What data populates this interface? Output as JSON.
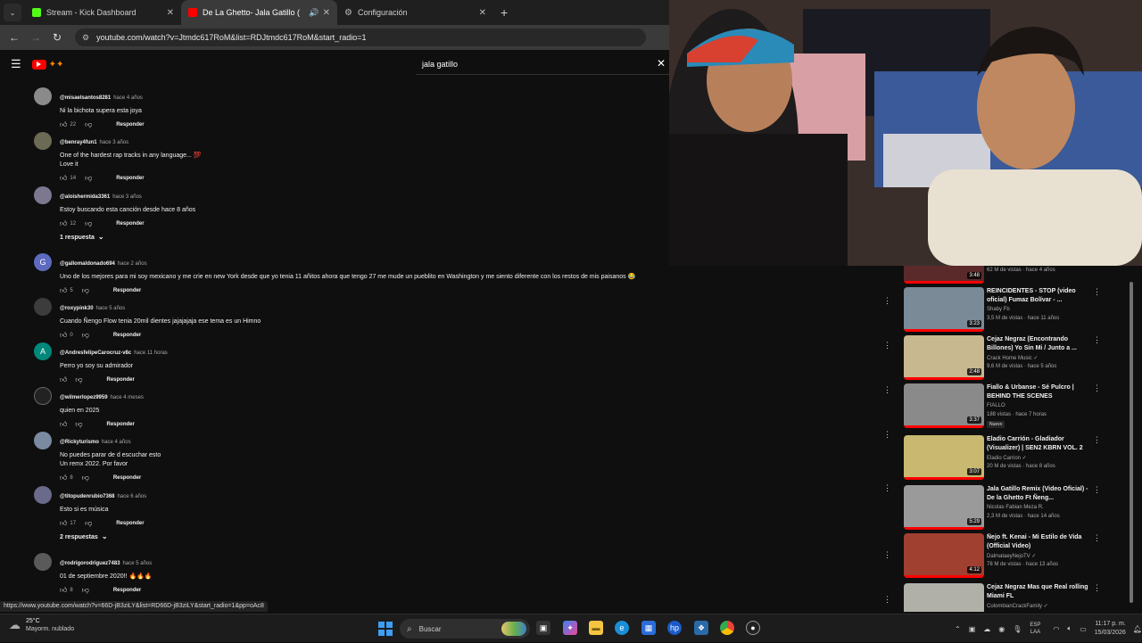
{
  "tabs": [
    {
      "label": "Stream - Kick Dashboard",
      "favicon_color": "#53fc18",
      "active": false
    },
    {
      "label": "De La Ghetto- Jala Gatillo (",
      "favicon_color": "#ff0000",
      "active": true
    },
    {
      "label": "Configuración",
      "favicon_color": "#bbbbbb",
      "active": false
    }
  ],
  "address_bar": {
    "url": "youtube.com/watch?v=Jtmdc617RoM&list=RDJtmdc617RoM&start_radio=1"
  },
  "search": {
    "query": "jala gatillo"
  },
  "comments": [
    {
      "author": "@misaelsantos8281",
      "time": "hace 4 años",
      "text": [
        "Ni la bichota supera esta joya"
      ],
      "likes": "22",
      "reply_label": "Responder",
      "avatar_letter": "",
      "avatar_color": "#8a8a8a"
    },
    {
      "author": "@benray4fun1",
      "time": "hace 3 años",
      "text": [
        "One of the hardest rap tracks in any language... 💯",
        "Love it"
      ],
      "likes": "14",
      "reply_label": "Responder",
      "avatar_letter": "",
      "avatar_color": "#6b6b55"
    },
    {
      "author": "@aloishermida3361",
      "time": "hace 3 años",
      "text": [
        "Estoy buscando esta canción desde hace 8 años"
      ],
      "likes": "12",
      "reply_label": "Responder",
      "avatar_letter": "",
      "avatar_color": "#7d7890"
    },
    {
      "author": "@gallomaldonado694",
      "time": "hace 2 años",
      "text": [
        "Uno de los mejores para mi soy mexicano y me crie en new York desde que yo tenia 11 añitos ahora que tengo 27 me mude un pueblito en Washington y me siento diferente con los restos de mis paisanos 😂"
      ],
      "likes": "5",
      "reply_label": "Responder",
      "avatar_letter": "G",
      "avatar_color": "#5c6bc0"
    },
    {
      "author": "@roxypink30",
      "time": "hace 5 años",
      "text": [
        "Cuando Ñengo Flow tenia 20mil dientes jajajajaja ese tema es un Himno"
      ],
      "likes": "0",
      "reply_label": "Responder",
      "avatar_letter": "",
      "avatar_color": "#3c3c3c"
    },
    {
      "author": "@AndresfelipeCarocruz-v8c",
      "time": "hace 11 horas",
      "text": [
        "Perro yo soy su admirador"
      ],
      "likes": "",
      "reply_label": "Responder",
      "avatar_letter": "A",
      "avatar_color": "#00897b"
    },
    {
      "author": "@wilmerlopez9959",
      "time": "hace 4 meses",
      "text": [
        "quien en 2025"
      ],
      "likes": "",
      "reply_label": "Responder",
      "avatar_letter": "",
      "avatar_color": "#222222"
    },
    {
      "author": "@Rickyturismo",
      "time": "hace 4 años",
      "text": [
        "No puedes parar de d escuchar esto",
        "Un remx 2022. Por favor"
      ],
      "likes": "8",
      "reply_label": "Responder",
      "avatar_letter": "",
      "avatar_color": "#7a8aa0"
    },
    {
      "author": "@titopudenrubio7368",
      "time": "hace 6 años",
      "text": [
        "Esto si es música"
      ],
      "likes": "17",
      "reply_label": "Responder",
      "avatar_letter": "",
      "avatar_color": "#6a6a8a"
    },
    {
      "author": "@rodrigorodriguez7483",
      "time": "hace 5 años",
      "text": [
        "01 de septiembre 2020!! 🔥🔥🔥"
      ],
      "likes": "8",
      "reply_label": "Responder",
      "avatar_letter": "",
      "avatar_color": "#5a5a5a"
    }
  ],
  "reply_toggles": [
    "1 respuesta",
    "2 respuestas"
  ],
  "recommendations": [
    {
      "title": "",
      "channel": "",
      "meta": "62 M de vistas · hace 4 años",
      "duration": "3:48",
      "thumb": "#5a2a2a",
      "badge": "vevo"
    },
    {
      "title": "REINCIDENTES - STOP (video oficial) Fumaz Bolívar - ...",
      "channel": "Shaby Fb",
      "meta": "3,5 M de vistas · hace 11 años",
      "duration": "3:23",
      "thumb": "#7a8a96"
    },
    {
      "title": "Cejaz Negraz (Encontrando Billones) Yo Sin Mi / Junto a ...",
      "channel": "Crack Home Music ✓",
      "meta": "9,6 M de vistas · hace 5 años",
      "duration": "2:48",
      "thumb": "#c8b890"
    },
    {
      "title": "Fiallo & Urbanse - Sé Pulcro | BEHIND THE SCENES",
      "channel": "FIALLO",
      "meta": "188 vistas · hace 7 horas",
      "duration": "3:37",
      "thumb": "#8a8a8a",
      "new_label": "Nuevo"
    },
    {
      "title": "Eladio Carrión - Gladiador (Visualizer) | SEN2 KBRN VOL. 2",
      "channel": "Eladio Carrion ✓",
      "meta": "20 M de vistas · hace 8 años",
      "duration": "3:07",
      "thumb": "#c8b870"
    },
    {
      "title": "Jala Gatillo Remix (Video Oficial) - De la Ghetto Ft Ñeng...",
      "channel": "Nicolas Fabian Meza R.",
      "meta": "2,3 M de vistas · hace 14 años",
      "duration": "5:29",
      "thumb": "#9a9a9a"
    },
    {
      "title": "Ñejo ft. Kenai - Mi Estilo de Vida (Official Video)",
      "channel": "DalmataeyNejoTV ✓",
      "meta": "78 M de vistas · hace 13 años",
      "duration": "4:12",
      "thumb": "#a04030"
    },
    {
      "title": "Cejaz Negraz Mas que Real rolling Miami FL",
      "channel": "ColombianCrackFamily ✓",
      "meta": "",
      "duration": "",
      "thumb": "#b0b0a8"
    }
  ],
  "status_url": "https://www.youtube.com/watch?v=66D-jB3ziLY&list=RD66D-jB3ziLY&start_radio=1&pp=oAc8",
  "taskbar": {
    "weather_temp": "25°C",
    "weather_desc": "Mayorm. nublado",
    "search_placeholder": "Buscar",
    "lang1": "ESP",
    "lang2": "LAA",
    "time": "11:17 p. m.",
    "date": "15/03/2026"
  }
}
